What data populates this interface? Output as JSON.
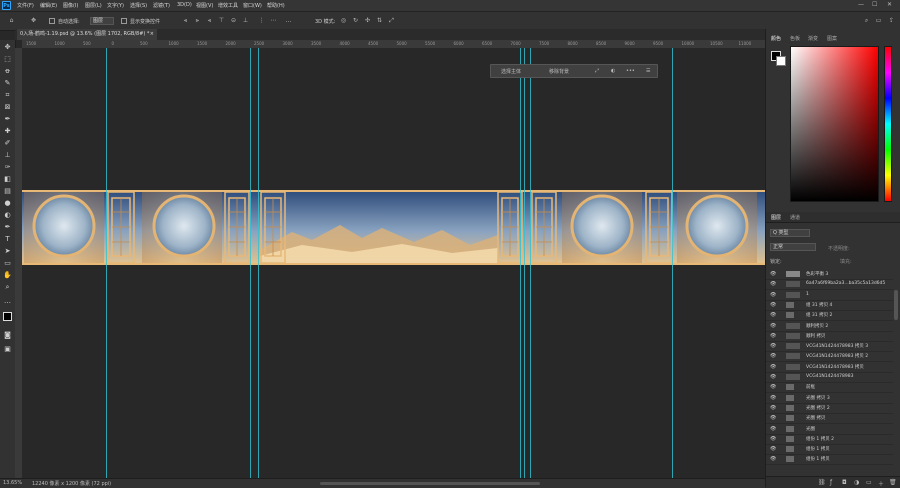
{
  "menu": {
    "logo": "Ps",
    "items": [
      "文件(F)",
      "编辑(E)",
      "图像(I)",
      "图层(L)",
      "文字(Y)",
      "选择(S)",
      "滤镜(T)",
      "3D(D)",
      "视图(V)",
      "增效工具",
      "窗口(W)",
      "帮助(H)"
    ],
    "win_min": "—",
    "win_max": "☐",
    "win_close": "✕"
  },
  "options": {
    "auto_select_label": "自动选择:",
    "auto_select_value": "图层",
    "show_transform_label": "显示变换控件",
    "mode3d_label": "3D 模式:"
  },
  "document": {
    "tab_title": "0入场-鹤鸣-1.19.psd @ 13.6% (图层 1702, RGB/8#) *",
    "tab_close": "×"
  },
  "ruler_ticks": [
    "1500",
    "1000",
    "500",
    "0",
    "500",
    "1000",
    "1500",
    "2000",
    "2500",
    "3000",
    "3500",
    "4000",
    "4500",
    "5000",
    "5500",
    "6000",
    "6500",
    "7000",
    "7500",
    "8000",
    "8500",
    "9000",
    "9500",
    "10000",
    "10500",
    "11000"
  ],
  "context_bar": {
    "select_subject": "选择主体",
    "remove_bg": "移除背景",
    "more": "•••"
  },
  "status": {
    "zoom": "13.65%",
    "doc_info": "12240 像素 x 1200 像素 (72 ppi)"
  },
  "panels": {
    "color_tabs": [
      "颜色",
      "色板",
      "渐变",
      "图案"
    ],
    "layers_tabs": [
      "图层",
      "通道"
    ],
    "filter_label": "Q 类型",
    "blend_mode": "正常",
    "opacity_label": "不透明度:",
    "lock_label": "锁定:",
    "fill_label": "填充:"
  },
  "layers": [
    {
      "name": "色彩平衡 3",
      "kind": "adj"
    },
    {
      "name": "6a47a6f69ba2a3...ba35c5a13d6d5",
      "kind": "img"
    },
    {
      "name": "1",
      "kind": "img"
    },
    {
      "name": "组 31 拷贝 4",
      "kind": "group"
    },
    {
      "name": "组 31 拷贝 2",
      "kind": "group"
    },
    {
      "name": "顺利拷贝 2",
      "kind": "img"
    },
    {
      "name": "顺利 拷贝",
      "kind": "img"
    },
    {
      "name": "VCG41N1424478983 拷贝 3",
      "kind": "img"
    },
    {
      "name": "VCG41N1424478983 拷贝 2",
      "kind": "img"
    },
    {
      "name": "VCG41N1424478983 拷贝",
      "kind": "img"
    },
    {
      "name": "VCG41N1424478983",
      "kind": "img"
    },
    {
      "name": "前框",
      "kind": "group"
    },
    {
      "name": "光圈 拷贝 3",
      "kind": "group"
    },
    {
      "name": "光圈 拷贝 2",
      "kind": "group"
    },
    {
      "name": "光圈 拷贝",
      "kind": "group"
    },
    {
      "name": "光圈",
      "kind": "group"
    },
    {
      "name": "组份 1 拷贝 2",
      "kind": "group"
    },
    {
      "name": "组份 1 拷贝",
      "kind": "group"
    },
    {
      "name": "组份 1 拷贝",
      "kind": "group"
    }
  ],
  "colors": {
    "accent": "#31a8ff",
    "guide": "#2fc4d6",
    "artwork_gold": "#d3a067",
    "artwork_sky": "#2c4a7a"
  }
}
